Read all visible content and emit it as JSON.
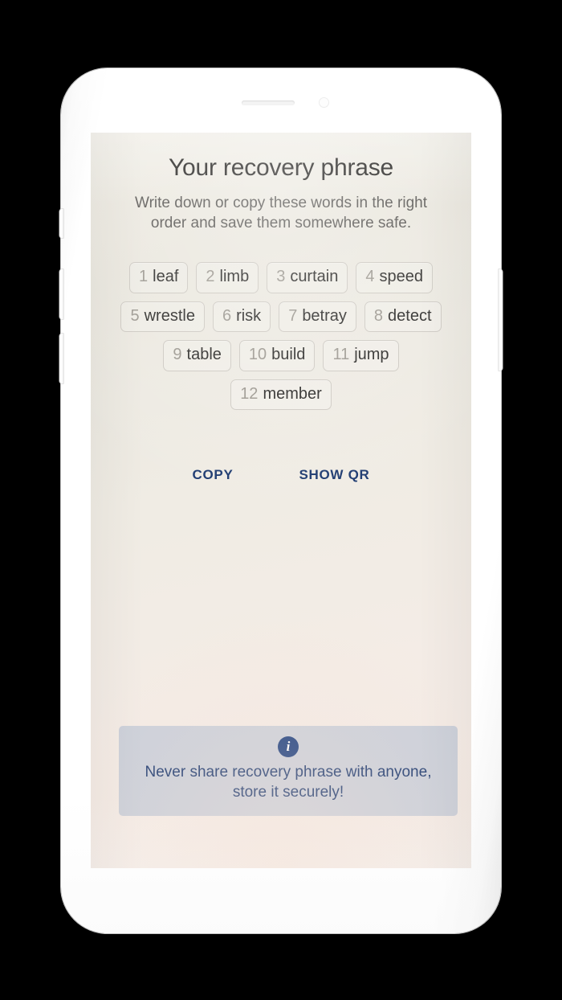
{
  "device": {
    "type": "white-smartphone",
    "earpiece": "earpiece-speaker",
    "camera": "front-camera",
    "buttons": [
      "mute-switch",
      "volume-up",
      "volume-down",
      "power"
    ]
  },
  "screen": {
    "title": "Your recovery phrase",
    "subtitle": "Write down or copy these words in the right order and save them somewhere safe.",
    "background_color": "#efeae2"
  },
  "recovery_phrase": {
    "word_count": 12,
    "words": [
      {
        "index": "1",
        "word": "leaf"
      },
      {
        "index": "2",
        "word": "limb"
      },
      {
        "index": "3",
        "word": "curtain"
      },
      {
        "index": "4",
        "word": "speed"
      },
      {
        "index": "5",
        "word": "wrestle"
      },
      {
        "index": "6",
        "word": "risk"
      },
      {
        "index": "7",
        "word": "betray"
      },
      {
        "index": "8",
        "word": "detect"
      },
      {
        "index": "9",
        "word": "table"
      },
      {
        "index": "10",
        "word": "build"
      },
      {
        "index": "11",
        "word": "jump"
      },
      {
        "index": "12",
        "word": "member"
      }
    ],
    "index_color": "#9a968e",
    "word_color": "#272624"
  },
  "actions": {
    "copy_label": "COPY",
    "show_qr_label": "SHOW QR",
    "accent_color": "#1d3a70"
  },
  "info_banner": {
    "icon": "info-circle-icon",
    "icon_glyph": "i",
    "text": "Never share recovery phrase with anyone, store it securely!",
    "background_color": "#cbd0da",
    "text_color": "#1d3a70",
    "icon_color": "#1b3e7e"
  }
}
